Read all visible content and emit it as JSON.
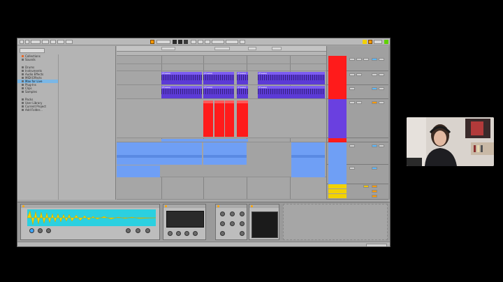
{
  "window": {
    "title": "Ableton Live",
    "statusbar_text": "",
    "device_hint": ""
  },
  "toolbar": {
    "link_label": "Link",
    "tempo": "",
    "signature": "",
    "bar_position": "",
    "cpu": "",
    "accent_orange": "#ff9a00"
  },
  "browser": {
    "categories": [
      "Collections",
      "Sounds",
      "Drums",
      "Instruments",
      "Audio Effects",
      "MIDI Effects",
      "Max for Live",
      "Plug-Ins",
      "Clips",
      "Samples"
    ],
    "places": [
      "Packs",
      "User Library",
      "Current Project",
      "Add Folder..."
    ],
    "selected_index": 6,
    "files": [
      "",
      "",
      ""
    ]
  },
  "arrangement": {
    "markers": [
      "",
      "",
      "",
      ""
    ],
    "colors": {
      "purple": "#5c3ad6",
      "red": "#ff1b1b",
      "blue": "#6f9ff5"
    },
    "clip_label": "(Freeze)"
  },
  "tracks": [
    {
      "name": "",
      "color": "#ff1b1b"
    },
    {
      "name": "",
      "color": "#ff1b1b"
    },
    {
      "name": "",
      "color": "#5c3ad6"
    },
    {
      "name": "",
      "color": "#ff1b1b"
    },
    {
      "name": "",
      "color": "#6f9ff5"
    },
    {
      "name": "",
      "color": "#6f9ff5"
    },
    {
      "name": "",
      "color": "#f2d200"
    }
  ],
  "devices": {
    "simpler_title": "",
    "drum_title": "",
    "eq_title": "",
    "rack_title": ""
  }
}
